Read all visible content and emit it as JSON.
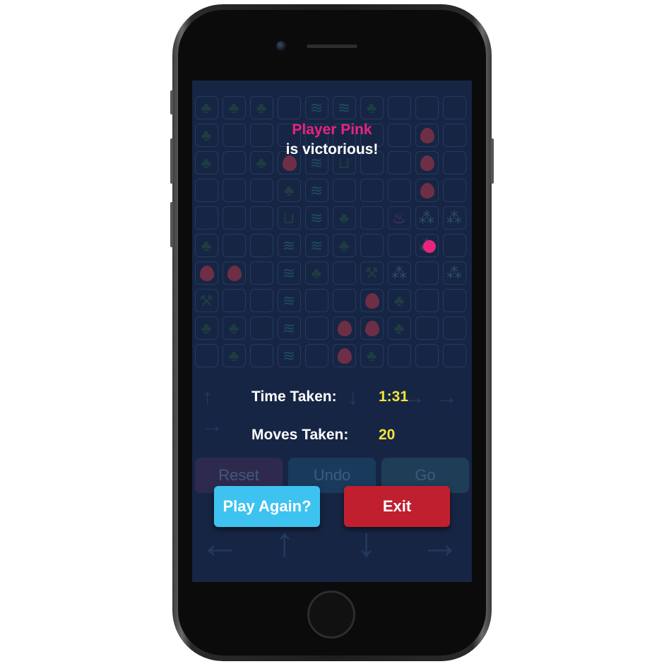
{
  "winner": {
    "player": "Player Pink",
    "message": "is victorious!"
  },
  "stats": {
    "time_label": "Time Taken:",
    "time_value": "1:31",
    "moves_label": "Moves Taken:",
    "moves_value": "20"
  },
  "background_controls": {
    "reset": "Reset",
    "undo": "Undo",
    "go": "Go"
  },
  "dialog_buttons": {
    "play_again": "Play Again?",
    "exit": "Exit"
  },
  "colors": {
    "screen_bg": "#172544",
    "player_pink": "#e8247d",
    "stat_value": "#f3e53a",
    "play_again": "#3ec3f0",
    "exit": "#c01f2f"
  },
  "icons": [
    "tree-icon",
    "water-icon",
    "fire-icon",
    "bucket-icon",
    "axe-icon",
    "paw-icon",
    "cup-icon",
    "chevron-arrow-icon"
  ]
}
